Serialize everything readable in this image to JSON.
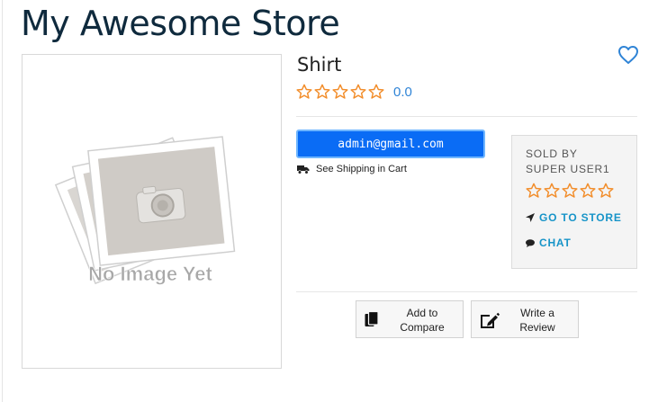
{
  "store": {
    "title": "My Awesome Store"
  },
  "product": {
    "name": "Shirt",
    "rating_value": "0.0",
    "rating_stars": 0,
    "image_placeholder_text": "No Image Yet"
  },
  "account": {
    "email": "admin@gmail.com"
  },
  "shipping": {
    "text": "See Shipping in Cart",
    "icon": "truck-icon"
  },
  "seller": {
    "sold_by_label": "SOLD BY",
    "name": "SUPER USER1",
    "rating_stars": 0,
    "go_to_store": "GO TO STORE",
    "chat": "CHAT"
  },
  "actions": {
    "compare": "Add to\nCompare",
    "review": "Write a\nReview"
  },
  "colors": {
    "title": "#0f2a3d",
    "star": "#f28c28",
    "accent_blue": "#2f84d6",
    "button_blue": "#0a6cf5",
    "link_teal": "#1794c8"
  }
}
